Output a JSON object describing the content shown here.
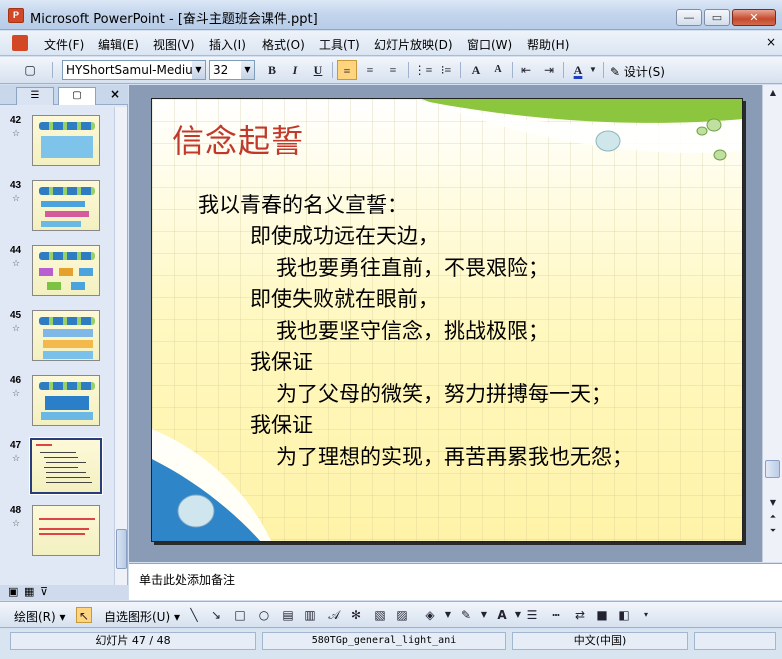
{
  "window": {
    "app_icon_text": "P",
    "title": "Microsoft PowerPoint - [奋斗主题班会课件.ppt]",
    "minimize_symbol": "—",
    "maximize_symbol": "▭",
    "close_symbol": "✕"
  },
  "menu": {
    "items": [
      "文件(F)",
      "编辑(E)",
      "视图(V)",
      "插入(I)",
      "格式(O)",
      "工具(T)",
      "幻灯片放映(D)",
      "窗口(W)",
      "帮助(H)"
    ],
    "close_symbol": "×"
  },
  "toolbar": {
    "font_name": "HYShortSamul-Mediu",
    "font_size": "32",
    "bold": "B",
    "italic": "I",
    "underline": "U",
    "increase_font": "A",
    "decrease_font": "A",
    "font_color": "A",
    "design_label": "设计(S)"
  },
  "left_panel": {
    "tab_outline_symbol": "☰",
    "tab_slides_symbol": "▢",
    "close_symbol": "×",
    "slides": [
      {
        "number": "42"
      },
      {
        "number": "43"
      },
      {
        "number": "44"
      },
      {
        "number": "45"
      },
      {
        "number": "46"
      },
      {
        "number": "47"
      },
      {
        "number": "48"
      }
    ],
    "star": "☆"
  },
  "slide": {
    "title": "信念起誓",
    "lines": [
      "我以青春的名义宣誓：",
      "即使成功远在天边，",
      "我也要勇往直前，不畏艰险；",
      "即使失败就在眼前，",
      "我也要坚守信念，挑战极限；",
      "我保证",
      "为了父母的微笑，努力拼搏每一天；",
      "我保证",
      "为了理想的实现，再苦再累我也无怨；"
    ]
  },
  "notes": {
    "placeholder": "单击此处添加备注"
  },
  "draw_toolbar": {
    "draw_label": "绘图(R)",
    "autoshape_label": "自选图形(U)"
  },
  "status": {
    "slide_position": "幻灯片 47 / 48",
    "design_template": "580TGp_general_light_ani",
    "language": "中文(中国)"
  },
  "colors": {
    "title_red": "#c0392b",
    "accent_green": "#8cc63f",
    "accent_blue": "#2e86c9"
  }
}
